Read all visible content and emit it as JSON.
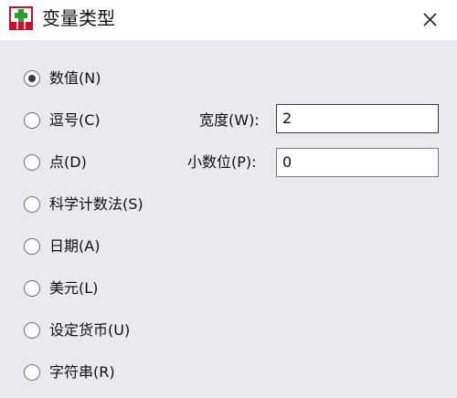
{
  "window": {
    "title": "变量类型",
    "close_symbol": "✕"
  },
  "radio_options": [
    {
      "label": "数值(N)",
      "selected": true
    },
    {
      "label": "逗号(C)",
      "selected": false
    },
    {
      "label": "点(D)",
      "selected": false
    },
    {
      "label": "科学计数法(S)",
      "selected": false
    },
    {
      "label": "日期(A)",
      "selected": false
    },
    {
      "label": "美元(L)",
      "selected": false
    },
    {
      "label": "设定货币(U)",
      "selected": false
    },
    {
      "label": "字符串(R)",
      "selected": false
    }
  ],
  "fields": {
    "width": {
      "label": "宽度(W):",
      "value": "2"
    },
    "decimals": {
      "label": "小数位(P):",
      "value": "0"
    }
  },
  "icons": {
    "app_icon": "spss-variable-type-icon",
    "close_icon": "close-icon"
  },
  "colors": {
    "background": "#e9e9ee",
    "titlebar": "#ffffff",
    "icon_red": "#c8102e",
    "icon_green": "#2e9e2e"
  }
}
